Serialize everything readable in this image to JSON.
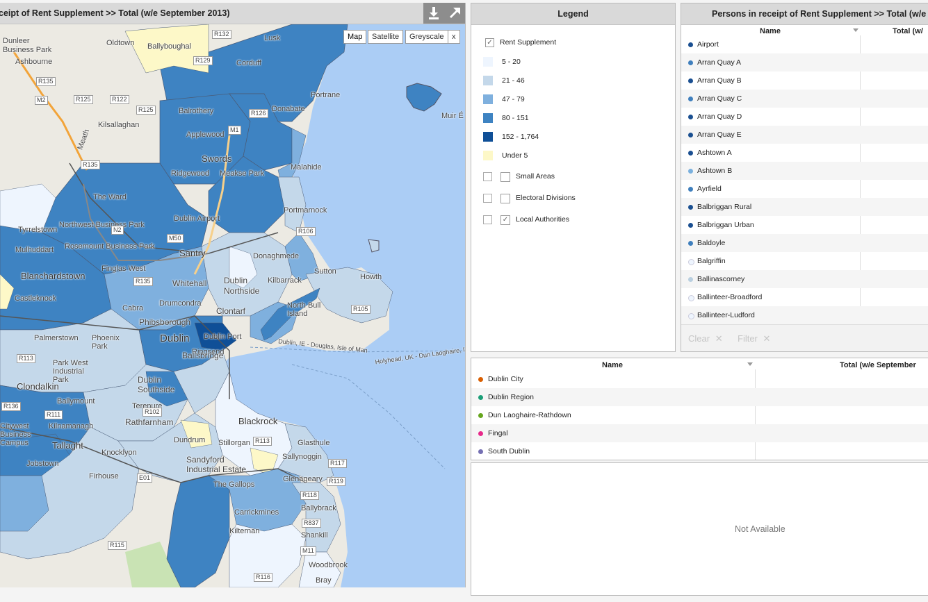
{
  "map_panel": {
    "title": "ceipt of Rent Supplement >>  Total (w/e September 2013)",
    "download_icon": "download-icon",
    "expand_icon": "expand-icon",
    "map_types": [
      "Map",
      "Satellite",
      "Greyscale",
      "x"
    ],
    "active_map_type": "Map",
    "place_labels": [
      "Ashbourne",
      "Oldtown",
      "Ballyboughal",
      "Lusk",
      "Corduff",
      "Portrane",
      "Donabate",
      "Balrothery",
      "Kilsallaghan",
      "Applewood",
      "Swords",
      "Ridgewood",
      "Meakse Park",
      "Malahide",
      "The Ward",
      "Dublin Airport",
      "Northwest Business Park",
      "Tyrrelstown",
      "Mulhuddart",
      "Rosemount Business Park",
      "Blanchardstown",
      "Finglas West",
      "Santry",
      "Donaghmede",
      "Portmarnock",
      "Whitehall",
      "Dublin Northside",
      "Kilbarrack",
      "Sutton",
      "Howth",
      "Castleknock",
      "Cabra",
      "Drumcondra",
      "Clontarf",
      "North Bull Island",
      "Phibsborough",
      "Dublin",
      "Phoenix Park",
      "Dublin Port",
      "Palmerstown",
      "Ringsend",
      "Park West Industrial Park",
      "Ballsbridge",
      "Clondalkin",
      "Dublin Southside",
      "Ballymount",
      "Terenure",
      "Kilnamanagh",
      "Rathfarnham",
      "Blackrock",
      "Tallaght",
      "Knocklyon",
      "Dundrum",
      "Stillorgan",
      "Sallynoggin",
      "Glasthule",
      "Sandyford Industrial Estate",
      "Jobstown",
      "Firhouse",
      "Glenageary",
      "The Gallops",
      "Carrickmines",
      "Kilternan",
      "Shankill",
      "Woodbrook",
      "Ballybrack",
      "Muir É",
      "Citywest Business Campus",
      "Dublin, IE - Douglas, Isle of Man",
      "Holyhead, UK - Dun Laoghaire, IE",
      "Business Park",
      "Dunleer",
      "Bray",
      "Meath"
    ],
    "road_labels": [
      "R135",
      "R125",
      "R122",
      "R125",
      "R129",
      "R126",
      "R132",
      "M1",
      "R135",
      "R106",
      "R135",
      "R111",
      "R113",
      "R136",
      "R113",
      "R117",
      "R118",
      "R837",
      "R115",
      "R116",
      "E01",
      "M50",
      "R102",
      "M2",
      "N2",
      "M11",
      "R105",
      "R119"
    ]
  },
  "legend_panel": {
    "title": "Legend",
    "layer_label": "Rent Supplement",
    "bins": [
      {
        "label": "5 - 20",
        "color": "#eef5fe"
      },
      {
        "label": "21 - 46",
        "color": "#c4d8ea"
      },
      {
        "label": "47 - 79",
        "color": "#7fb0de"
      },
      {
        "label": "80 - 151",
        "color": "#3e83c2"
      },
      {
        "label": "152 - 1,764",
        "color": "#0f4f97"
      },
      {
        "label": "Under 5",
        "color": "#fdf8c8"
      }
    ],
    "boundaries": [
      {
        "label": "Small Areas",
        "checked": false
      },
      {
        "label": "Electoral Divisions",
        "checked": false
      },
      {
        "label": "Local Authorities",
        "checked": true
      }
    ]
  },
  "persons_panel": {
    "title": "Persons in receipt of Rent Supplement >>  Total (w/e",
    "col_name": "Name",
    "col_total": "Total (w/",
    "rows": [
      {
        "name": "Airport",
        "color": "#1a4f91"
      },
      {
        "name": "Arran Quay A",
        "color": "#3f7fbd"
      },
      {
        "name": "Arran Quay B",
        "color": "#1a4f91"
      },
      {
        "name": "Arran Quay C",
        "color": "#3f7fbd"
      },
      {
        "name": "Arran Quay D",
        "color": "#1a4f91"
      },
      {
        "name": "Arran Quay E",
        "color": "#1a4f91"
      },
      {
        "name": "Ashtown A",
        "color": "#1a4f91"
      },
      {
        "name": "Ashtown B",
        "color": "#7ab0de"
      },
      {
        "name": "Ayrfield",
        "color": "#3f7fbd"
      },
      {
        "name": "Balbriggan Rural",
        "color": "#1a4f91"
      },
      {
        "name": "Balbriggan Urban",
        "color": "#1a4f91"
      },
      {
        "name": "Baldoyle",
        "color": "#3f7fbd"
      },
      {
        "name": "Balgriffin",
        "color": "#eef5fe"
      },
      {
        "name": "Ballinascorney",
        "color": "#b9cfe0"
      },
      {
        "name": "Ballinteer-Broadford",
        "color": "#eef5fe"
      },
      {
        "name": "Ballinteer-Ludford",
        "color": "#eef5fe"
      }
    ],
    "clear_label": "Clear",
    "filter_label": "Filter"
  },
  "la_panel": {
    "col_name": "Name",
    "col_total": "Total (w/e September",
    "rows": [
      {
        "name": "Dublin City",
        "color": "#d95f02"
      },
      {
        "name": "Dublin Region",
        "color": "#1b9e77"
      },
      {
        "name": "Dun Laoghaire-Rathdown",
        "color": "#66a61e"
      },
      {
        "name": "Fingal",
        "color": "#e7298a"
      },
      {
        "name": "South Dublin",
        "color": "#7570b3"
      }
    ]
  },
  "na_panel": {
    "message": "Not Available"
  }
}
